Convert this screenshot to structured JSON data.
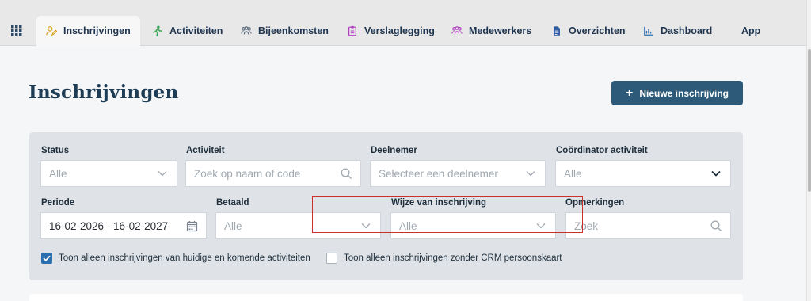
{
  "nav": {
    "tabs": [
      {
        "label": "Inschrijvingen",
        "icon": "user-pen-icon",
        "active": true
      },
      {
        "label": "Activiteiten",
        "icon": "person-running-icon"
      },
      {
        "label": "Bijeenkomsten",
        "icon": "users-icon"
      },
      {
        "label": "Verslaglegging",
        "icon": "clipboard-icon"
      },
      {
        "label": "Medewerkers",
        "icon": "team-icon"
      },
      {
        "label": "Overzichten",
        "icon": "document-icon"
      },
      {
        "label": "Dashboard",
        "icon": "chart-icon"
      },
      {
        "label": "App"
      }
    ]
  },
  "page": {
    "title": "Inschrijvingen",
    "new_button": "Nieuwe inschrijving"
  },
  "filters": {
    "status": {
      "label": "Status",
      "value": "Alle"
    },
    "activiteit": {
      "label": "Activiteit",
      "placeholder": "Zoek op naam of code"
    },
    "deelnemer": {
      "label": "Deelnemer",
      "placeholder": "Selecteer een deelnemer"
    },
    "coordinator": {
      "label": "Coördinator activiteit",
      "value": "Alle"
    },
    "periode": {
      "label": "Periode",
      "value": "16-02-2026 - 16-02-2027"
    },
    "betaald": {
      "label": "Betaald",
      "value": "Alle"
    },
    "wijze": {
      "label": "Wijze van inschrijving",
      "value": "Alle"
    },
    "opmerkingen": {
      "label": "Opmerkingen",
      "placeholder": "Zoek"
    },
    "check_current": {
      "label": "Toon alleen inschrijvingen van huidige en komende activiteiten",
      "checked": true
    },
    "check_crm": {
      "label": "Toon alleen inschrijvingen zonder CRM persoonskaart",
      "checked": false
    }
  },
  "colors": {
    "accent": "#2c5a78",
    "checkbox": "#2c6fb0",
    "highlight": "#c9302c"
  }
}
